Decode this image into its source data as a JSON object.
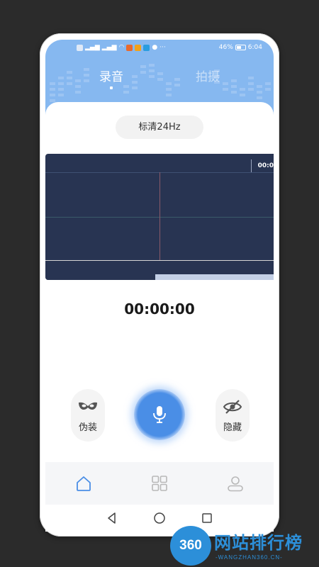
{
  "status_bar": {
    "left_icons": [
      "hd-icon",
      "signal-icon",
      "signal-icon",
      "wifi-icon",
      "app-notification-icon",
      "app-notification-icon",
      "app-notification-icon",
      "message-icon",
      "more-icon"
    ],
    "battery": "46%",
    "time": "6:04"
  },
  "tabs": [
    {
      "label": "录音",
      "active": true
    },
    {
      "label": "拍摄",
      "active": false
    }
  ],
  "quality_label": "标清24Hz",
  "waveform": {
    "time_mark": "00:0",
    "playback_progress": 0.48
  },
  "timer": "00:00:00",
  "actions": {
    "disguise_label": "伪装",
    "hide_label": "隐藏",
    "record_icon": "microphone-icon"
  },
  "bottom_nav": [
    {
      "icon": "home-icon",
      "active": true
    },
    {
      "icon": "grid-icon",
      "active": false
    },
    {
      "icon": "user-icon",
      "active": false
    }
  ],
  "system_nav": [
    "back-icon",
    "home-circle-icon",
    "recents-icon"
  ],
  "watermark": {
    "logo": "360",
    "title": "网站排行榜",
    "subtitle": "-WANGZHAN360.CN-"
  },
  "colors": {
    "header_blue": "#86b8f0",
    "accent_blue": "#4a8ee6",
    "waveform_bg": "#283452",
    "watermark_blue": "#2c8fd9"
  }
}
